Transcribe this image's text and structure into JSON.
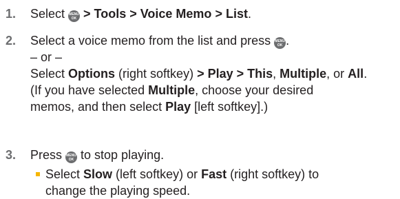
{
  "steps": [
    {
      "number": "1.",
      "line1": {
        "pre": "Select ",
        "key": "MENU OK",
        "sep1": " > ",
        "tools": "Tools",
        "sep2": " > ",
        "voice_memo": "Voice Memo",
        "sep3": " > ",
        "list": "List",
        "end": "."
      }
    },
    {
      "number": "2.",
      "line1": {
        "pre": "Select a voice memo from the list and press ",
        "key": "MENU OK",
        "end": "."
      },
      "or": "– or –",
      "line3": {
        "pre": "Select ",
        "options": "Options",
        "mid": " (right softkey) ",
        "sep1": "> ",
        "play": "Play",
        "sep2": " > ",
        "this": "This",
        "comma": ", ",
        "multiple": "Multiple",
        "or": ", or ",
        "all": "All",
        "end": "."
      },
      "line4": {
        "pre": "(If you have selected ",
        "multiple": "Multiple",
        "end": ", choose your desired"
      },
      "line5": {
        "pre": "memos, and then select ",
        "play": "Play",
        "end": " [left softkey].)"
      }
    },
    {
      "number": "3.",
      "line1": {
        "pre": "Press ",
        "key": "MENU OK",
        "end": " to stop playing."
      },
      "bullet": {
        "line1_pre": "Select ",
        "slow": "Slow",
        "line1_mid": " (left softkey) or ",
        "fast": "Fast",
        "line1_end": " (right softkey) to",
        "line2": "change the playing speed."
      }
    }
  ],
  "colors": {
    "text": "#231f20",
    "number": "#6d6e70",
    "bullet": "#f6b600",
    "key": "#6d6e70"
  },
  "icons": {
    "menu_ok_key": "menu-ok-key-icon",
    "bullet": "square-bullet-icon"
  }
}
